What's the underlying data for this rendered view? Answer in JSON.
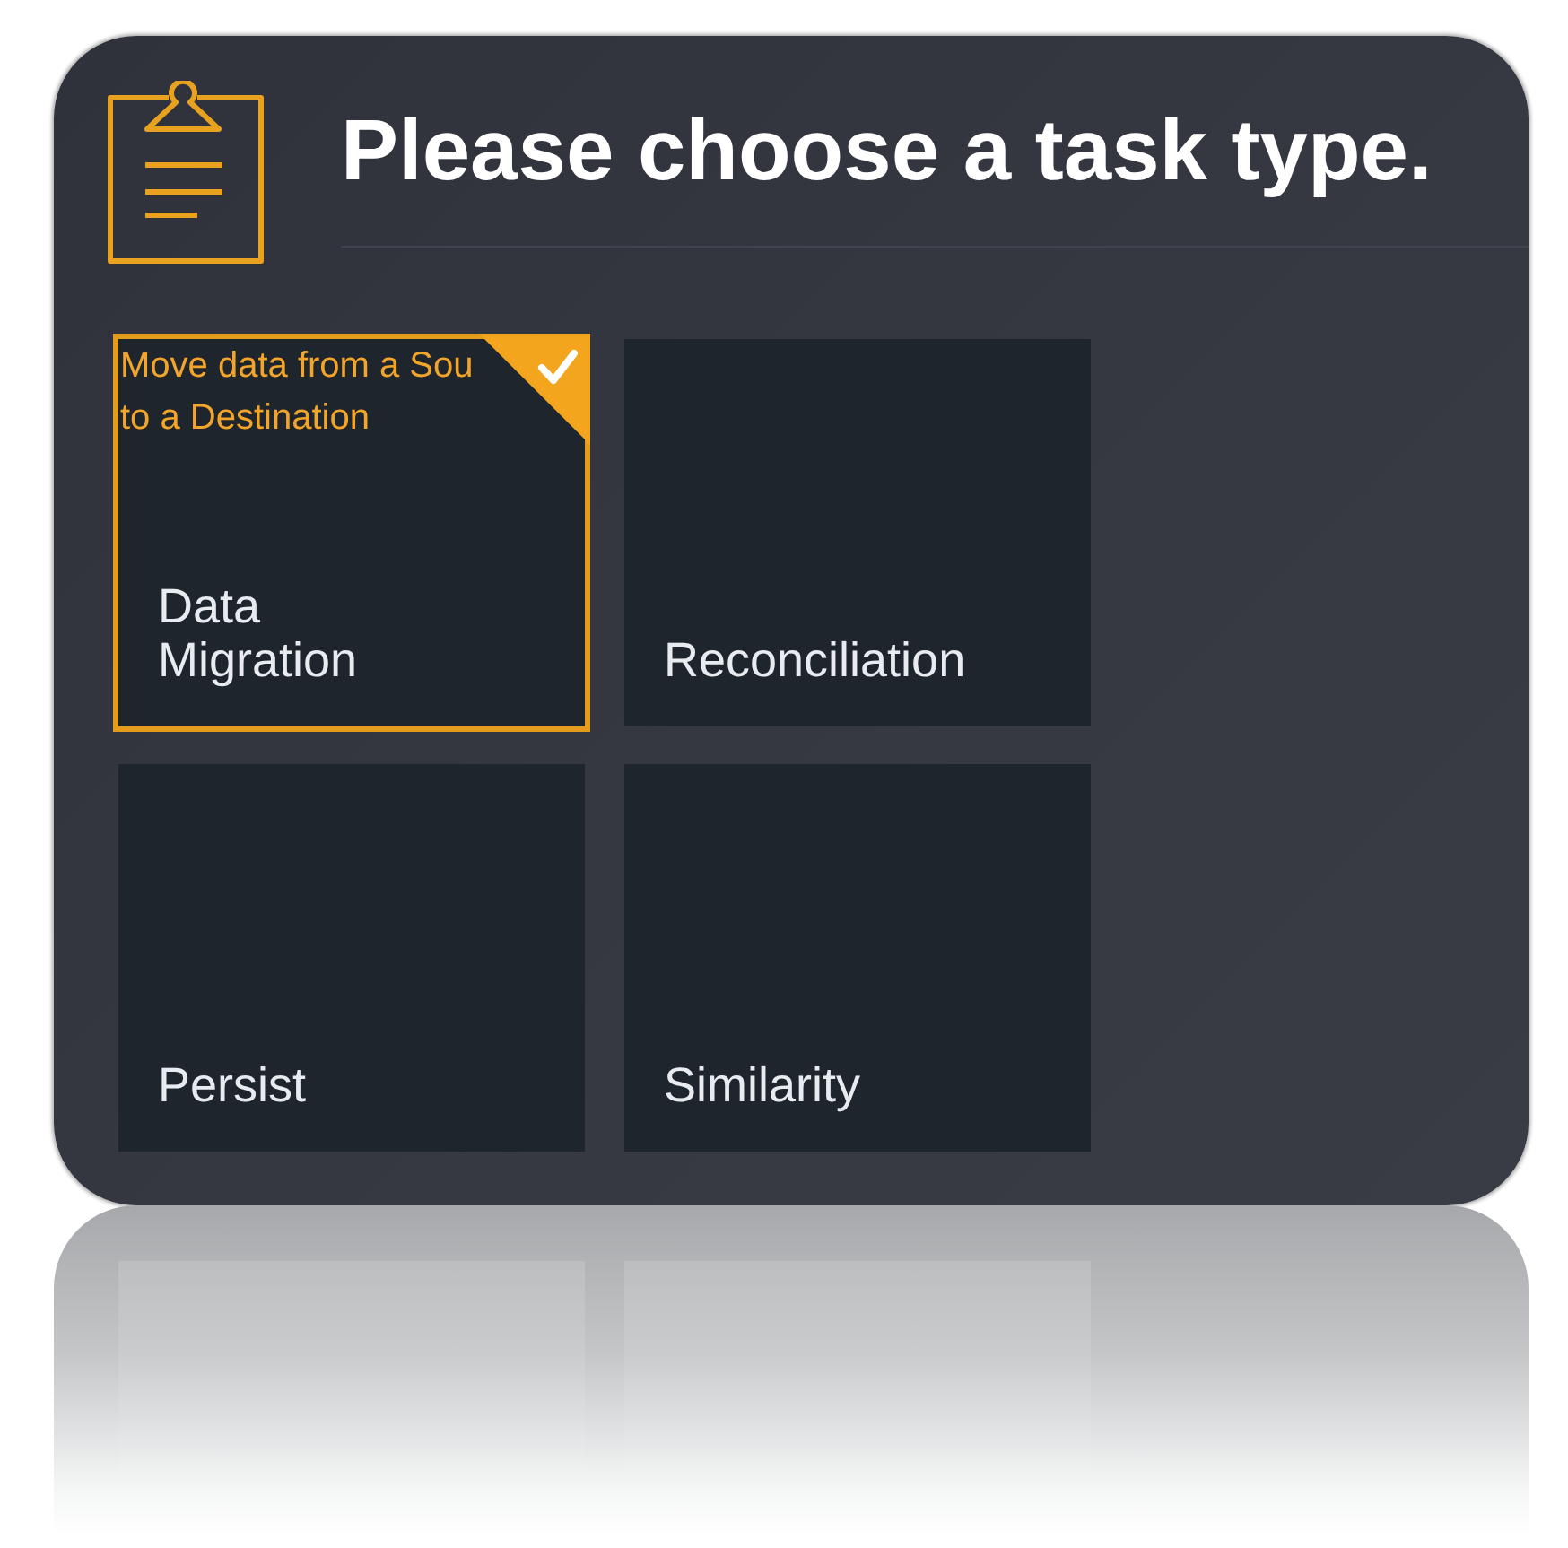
{
  "header": {
    "title": "Please choose a task type."
  },
  "tiles": [
    {
      "label": "Data\nMigration",
      "selected": true,
      "description": [
        "Move data from a Sou",
        "to a Destination"
      ]
    },
    {
      "label": "Reconciliation",
      "selected": false
    },
    {
      "label": "Persist",
      "selected": false
    },
    {
      "label": "Similarity",
      "selected": false
    }
  ]
}
